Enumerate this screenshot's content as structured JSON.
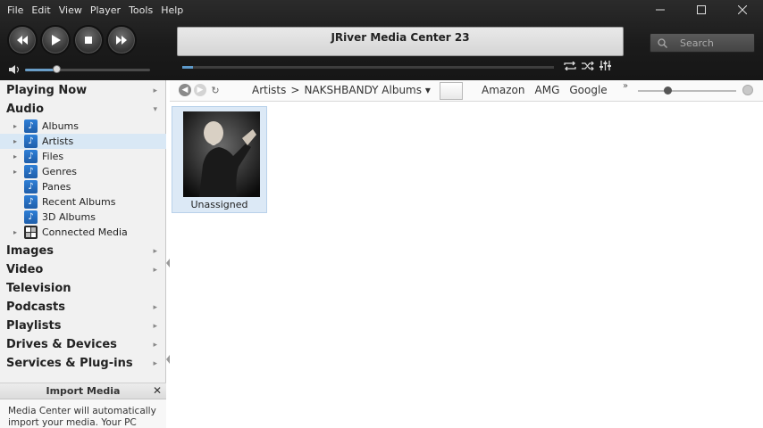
{
  "menu": [
    "File",
    "Edit",
    "View",
    "Player",
    "Tools",
    "Help"
  ],
  "window_controls": [
    "minimize-icon",
    "maximize-icon",
    "close-icon"
  ],
  "player": {
    "title": "JRiver Media Center 23",
    "volume": 0.25,
    "progress": 0.03
  },
  "search": {
    "placeholder": "Search"
  },
  "sidebar": {
    "sections": [
      {
        "label": "Playing Now",
        "expandable": true
      },
      {
        "label": "Audio",
        "expanded": true
      },
      {
        "label": "Images",
        "expandable": true
      },
      {
        "label": "Video",
        "expandable": true
      },
      {
        "label": "Television",
        "expandable": false
      },
      {
        "label": "Podcasts",
        "expandable": true
      },
      {
        "label": "Playlists",
        "expandable": true
      },
      {
        "label": "Drives & Devices",
        "expandable": true
      },
      {
        "label": "Services & Plug-ins",
        "expandable": true
      }
    ],
    "audio_items": [
      {
        "label": "Albums",
        "expandable": true
      },
      {
        "label": "Artists",
        "expandable": true,
        "selected": true
      },
      {
        "label": "Files",
        "expandable": true
      },
      {
        "label": "Genres",
        "expandable": true
      },
      {
        "label": "Panes",
        "expandable": false
      },
      {
        "label": "Recent Albums",
        "expandable": false
      },
      {
        "label": "3D Albums",
        "expandable": false
      },
      {
        "label": "Connected Media",
        "expandable": true
      }
    ]
  },
  "import_panel": {
    "title": "Import Media",
    "text": "Media Center will automatically import your media.  Your PC"
  },
  "toolbar": {
    "breadcrumb": [
      "Artists",
      ">",
      "NAKSHBANDY Albums ▾"
    ],
    "links": [
      "Amazon",
      "AMG",
      "Google"
    ],
    "more": "»",
    "zoom": 0.3
  },
  "content": {
    "tiles": [
      {
        "label": "Unassigned"
      }
    ]
  },
  "colors": {
    "accent": "#5d99c9",
    "selection": "#d9e8f5",
    "chrome": "#1b1b1b"
  }
}
